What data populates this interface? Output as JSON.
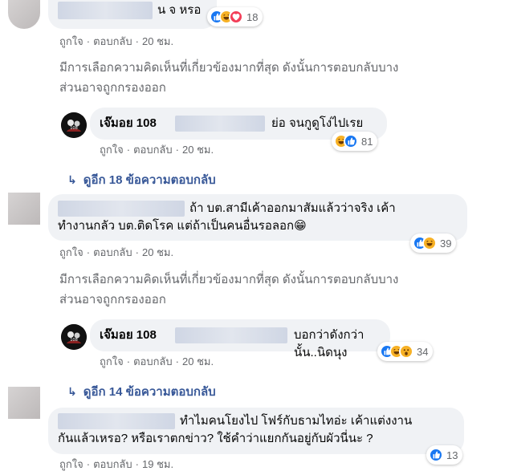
{
  "actions": {
    "like": "ถูกใจ",
    "reply": "ตอบกลับ",
    "sep": "·"
  },
  "comments": [
    {
      "suffix_text": "น จ หรอ",
      "time": "20 ชม.",
      "reaction_count": "18",
      "reactions": [
        "like-icon",
        "haha-icon",
        "love-icon"
      ],
      "notice": [
        "มีการเลือกความคิดเห็นที่เกี่ยวข้องมากที่สุด ดังนั้นการตอบกลับบาง",
        "ส่วนอาจถูกกรองออก"
      ],
      "reply": {
        "author": "เจ๊มอย 108",
        "text": "ย่อ จนกูดูโง่ไปเรย",
        "time": "20 ชม.",
        "reaction_count": "81",
        "reactions": [
          "haha-icon",
          "like-icon"
        ]
      },
      "more_replies": "ดูอีก 18 ข้อความตอบกลับ"
    },
    {
      "line1": "ถ้า บต.สามีเค้าออกมาสัมแล้วว่าจริง เค้า",
      "line2": "ทำงานกลัว บต.ติดโรค แต่ถ้าเป็นคนอื่นรอลอก😁",
      "time": "20 ชม.",
      "reaction_count": "39",
      "reactions": [
        "like-icon",
        "haha-icon"
      ],
      "notice": [
        "มีการเลือกความคิดเห็นที่เกี่ยวข้องมากที่สุด ดังนั้นการตอบกลับบาง",
        "ส่วนอาจถูกกรองออก"
      ],
      "reply": {
        "author": "เจ๊มอย 108",
        "text": "บอกว่าดังกว่านั้น..นิดนุง",
        "time": "20 ชม.",
        "reaction_count": "34",
        "reactions": [
          "like-icon",
          "haha-icon",
          "wow-icon"
        ]
      },
      "more_replies": "ดูอีก 14 ข้อความตอบกลับ"
    },
    {
      "line1": "ทำไมคนโยงไป โฟร์กับธามไทอ่ะ เค้าแต่งงาน",
      "line2": "กันแล้วเหรอ? หรือเราตกข่าว? ใช้คำว่าแยกกันอยู่กับผัวนี่นะ ?",
      "time": "19 ชม.",
      "reaction_count": "13",
      "reactions": [
        "like-icon"
      ]
    }
  ],
  "colors": {
    "like": "#1877f2",
    "haha": "#f7b125",
    "love": "#f33e58",
    "link": "#385898",
    "meta": "#65676b",
    "bubble": "#f0f2f5"
  }
}
